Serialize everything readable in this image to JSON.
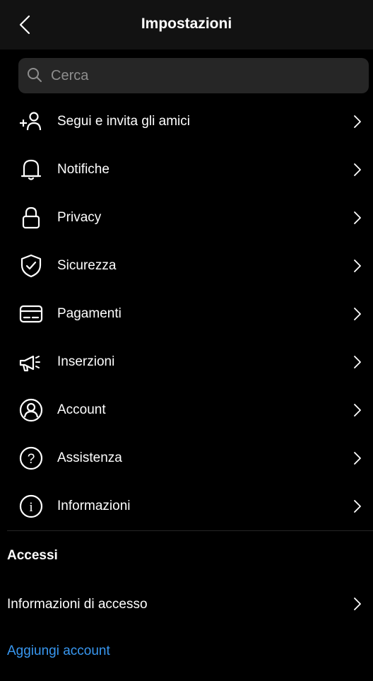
{
  "header": {
    "title": "Impostazioni",
    "back_icon": "chevron-left-icon"
  },
  "search": {
    "placeholder": "Cerca",
    "value": ""
  },
  "menu": {
    "items": [
      {
        "label": "Segui e invita gli amici",
        "icon": "add-person-icon"
      },
      {
        "label": "Notifiche",
        "icon": "bell-icon"
      },
      {
        "label": "Privacy",
        "icon": "lock-icon"
      },
      {
        "label": "Sicurezza",
        "icon": "shield-check-icon"
      },
      {
        "label": "Pagamenti",
        "icon": "credit-card-icon"
      },
      {
        "label": "Inserzioni",
        "icon": "megaphone-icon"
      },
      {
        "label": "Account",
        "icon": "account-circle-icon"
      },
      {
        "label": "Assistenza",
        "icon": "help-circle-icon"
      },
      {
        "label": "Informazioni",
        "icon": "info-circle-icon"
      }
    ]
  },
  "accessi": {
    "title": "Accessi",
    "login_info_label": "Informazioni di accesso",
    "add_account_label": "Aggiungi account"
  },
  "colors": {
    "background": "#000000",
    "header": "#121212",
    "search_bg": "#262626",
    "link": "#3897f0"
  }
}
